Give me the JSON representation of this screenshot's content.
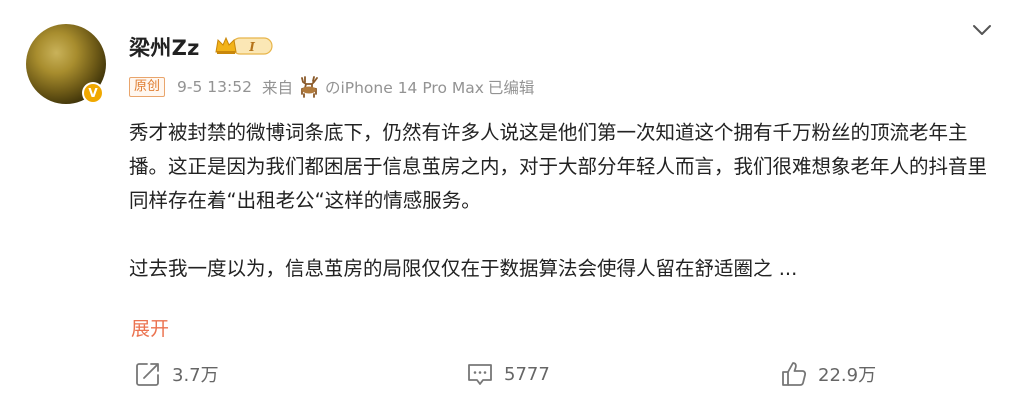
{
  "post": {
    "author": "梁州Zz",
    "vip_level": "I",
    "original_tag": "原创",
    "time": "9-5 13:52",
    "from_label": "来自",
    "device": "のiPhone 14 Pro Max",
    "edited_label": "已编辑",
    "paragraphs": [
      "秀才被封禁的微博词条底下，仍然有许多人说这是他们第一次知道这个拥有千万粉丝的顶流老年主播。这正是因为我们都困居于信息茧房之内，对于大部分年轻人而言，我们很难想象老年人的抖音里同样存在着“出租老公“这样的情感服务。",
      "过去我一度以为，信息茧房的局限仅仅在于数据算法会使得人留在舒适圈之 ..."
    ],
    "expand_label": "展开"
  },
  "actions": {
    "repost_count": "3.7万",
    "comment_count": "5777",
    "like_count": "22.9万"
  },
  "icons": {
    "menu": "chevron-down-icon",
    "repost": "repost-icon",
    "comment": "comment-icon",
    "like": "thumbs-up-icon",
    "verified": "verified-badge-icon",
    "vip": "vip-crown-icon",
    "source": "deer-icon"
  },
  "colors": {
    "accent": "#eb7350",
    "badge": "#f0a800",
    "meta": "#939393"
  }
}
